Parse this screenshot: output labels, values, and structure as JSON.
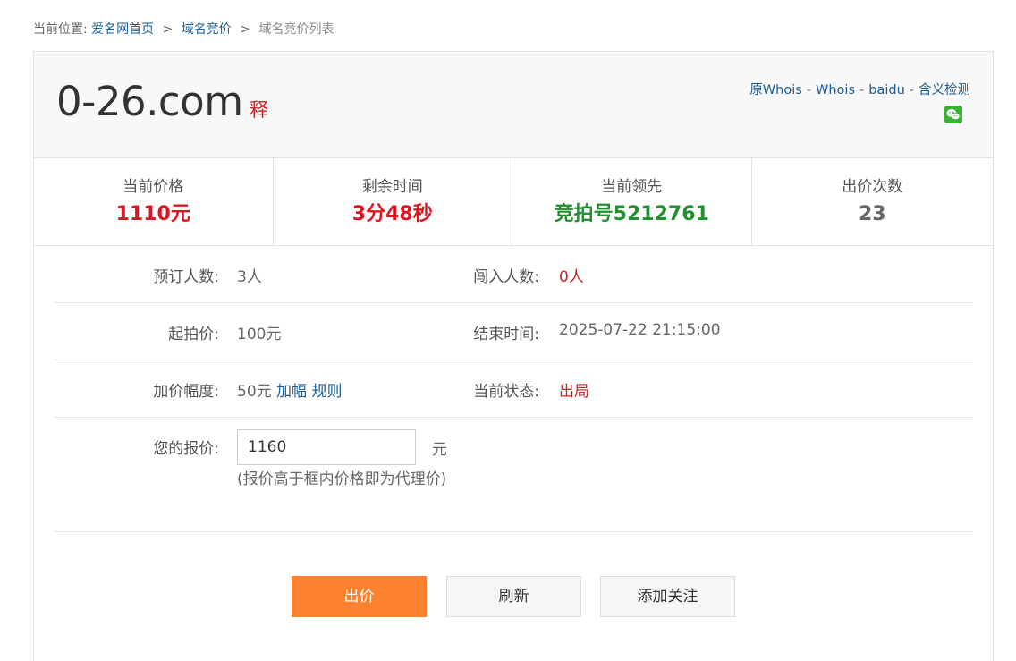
{
  "breadcrumb": {
    "prefix": "当前位置:",
    "home": "爱名网首页",
    "sep": ">",
    "section": "域名竞价",
    "current": "域名竞价列表"
  },
  "domain": {
    "name": "0-26.com",
    "shi": "释",
    "links": [
      "原Whois",
      "Whois",
      "baidu",
      "含义检测"
    ],
    "link_sep": "-"
  },
  "stats": [
    {
      "label": "当前价格",
      "value": "1110元"
    },
    {
      "label": "剩余时间",
      "value": "3分48秒"
    },
    {
      "label": "当前领先",
      "value": "竞拍号5212761"
    },
    {
      "label": "出价次数",
      "value": "23"
    }
  ],
  "details": {
    "reserve_label": "预订人数:",
    "reserve_value": "3人",
    "enter_label": "闯入人数:",
    "enter_value": "0人",
    "start_label": "起拍价:",
    "start_value": "100元",
    "end_label": "结束时间:",
    "end_value": "2025-07-22 21:15:00",
    "inc_label": "加价幅度:",
    "inc_value": "50元",
    "inc_link1": "加幅",
    "inc_link2": "规则",
    "status_label": "当前状态:",
    "status_value": "出局"
  },
  "bid": {
    "label": "您的报价:",
    "value": "1160",
    "unit": "元",
    "hint": "(报价高于框内价格即为代理价)"
  },
  "buttons": {
    "bid": "出价",
    "refresh": "刷新",
    "follow": "添加关注"
  },
  "colors": {
    "price": "#e0141e",
    "leader": "#21912f",
    "bid_button": "#fd8230",
    "link": "#1a5d99"
  }
}
